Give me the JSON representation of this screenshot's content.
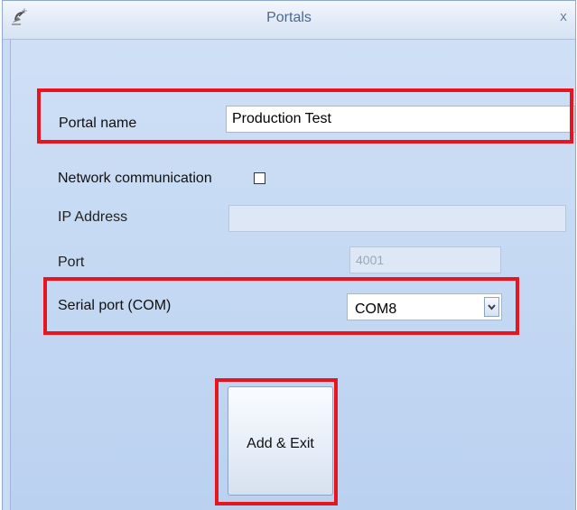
{
  "window": {
    "title": "Portals",
    "close_label": "x"
  },
  "form": {
    "portal_name_label": "Portal name",
    "portal_name_value": "Production Test",
    "network_label": "Network communication",
    "network_checked": false,
    "ip_label": "IP Address",
    "ip_value": "",
    "port_label": "Port",
    "port_value": "4001",
    "serial_label": "Serial port (COM)",
    "serial_value": "COM8",
    "submit_label": "Add & Exit"
  },
  "colors": {
    "highlight": "#e8141e",
    "window_bg": "#c9dcf5"
  },
  "icons": {
    "app": "satellite-dish-icon",
    "dropdown": "chevron-down-icon"
  }
}
